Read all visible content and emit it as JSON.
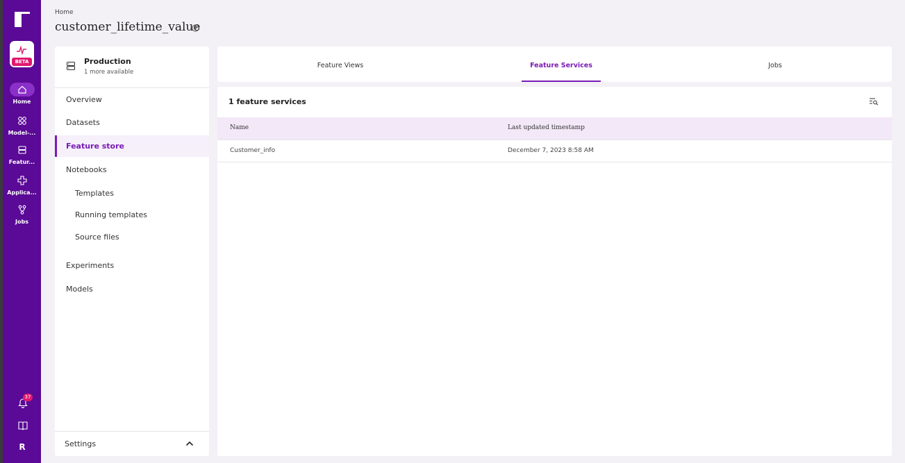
{
  "rail": {
    "beta_label": "BETA",
    "items": [
      {
        "label": "Home",
        "icon": "home-icon"
      },
      {
        "label": "Model-...",
        "icon": "model-icon"
      },
      {
        "label": "Featur...",
        "icon": "feature-store-icon"
      },
      {
        "label": "Applica...",
        "icon": "application-icon"
      },
      {
        "label": "Jobs",
        "icon": "jobs-icon"
      }
    ],
    "notification_count": "37",
    "avatar_initial": "R"
  },
  "header": {
    "breadcrumb": "Home",
    "title": "customer_lifetime_value"
  },
  "left_panel": {
    "environment": {
      "name": "Production",
      "sub": "1 more available"
    },
    "nav": [
      {
        "label": "Overview"
      },
      {
        "label": "Datasets"
      },
      {
        "label": "Feature store"
      },
      {
        "label": "Notebooks"
      },
      {
        "label": "Templates"
      },
      {
        "label": "Running templates"
      },
      {
        "label": "Source files"
      },
      {
        "label": "Experiments"
      },
      {
        "label": "Models"
      }
    ],
    "settings_label": "Settings"
  },
  "tabs": [
    {
      "label": "Feature Views"
    },
    {
      "label": "Feature Services"
    },
    {
      "label": "Jobs"
    }
  ],
  "table": {
    "heading": "1 feature services",
    "columns": [
      "Name",
      "Last updated timestamp"
    ],
    "rows": [
      [
        "Customer_info",
        "December 7, 2023 8:58 AM"
      ]
    ]
  },
  "colors": {
    "rail": "#5a0a96",
    "accent": "#7a1bb5",
    "badge": "#e0186f",
    "table_header": "#f2e8f7"
  }
}
